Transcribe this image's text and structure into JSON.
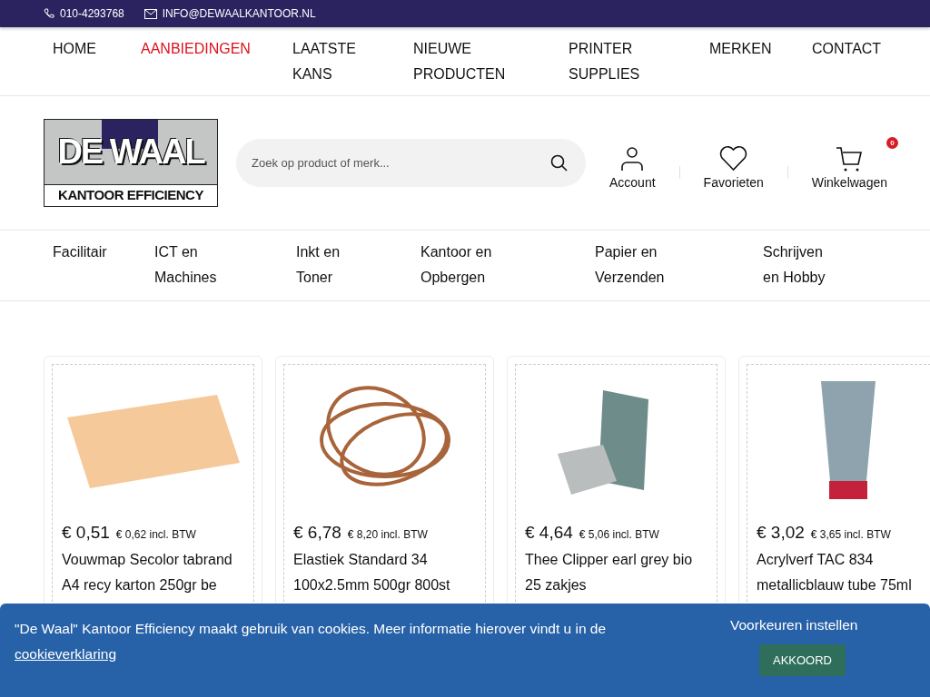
{
  "top_bar": {
    "phone": "010-4293768",
    "email": "INFO@DEWAALKANTOOR.NL"
  },
  "main_nav": [
    {
      "label": "HOME",
      "highlighted": false
    },
    {
      "label": "AANBIEDINGEN",
      "highlighted": true
    },
    {
      "label": "LAATSTE KANS",
      "highlighted": false
    },
    {
      "label": "NIEUWE PRODUCTEN",
      "highlighted": false
    },
    {
      "label": "PRINTER SUPPLIES",
      "highlighted": false
    },
    {
      "label": "MERKEN",
      "highlighted": false
    },
    {
      "label": "CONTACT",
      "highlighted": false
    }
  ],
  "header": {
    "logo": {
      "name": "DE WAAL",
      "tagline": "KANTOOR EFFICIENCY"
    },
    "search": {
      "placeholder": "Zoek op product of merk..."
    },
    "actions": [
      {
        "kind": "account",
        "label": "Account"
      },
      {
        "kind": "favorites",
        "label": "Favorieten"
      },
      {
        "kind": "cart",
        "label": "Winkelwagen",
        "badge": "0"
      }
    ]
  },
  "categories": [
    "Facilitair",
    "ICT en Machines",
    "Inkt en Toner",
    "Kantoor en Opbergen",
    "Papier en Verzenden",
    "Schrijven en Hobby"
  ],
  "products": [
    {
      "kind": "folder",
      "price": "€ 0,51",
      "price_incl": "€ 0,62 incl. BTW",
      "title": "Vouwmap Secolor tabrand A4 recy karton 250gr be"
    },
    {
      "kind": "bands",
      "price": "€ 6,78",
      "price_incl": "€ 8,20 incl. BTW",
      "title": "Elastiek Standard 34 100x2.5mm 500gr 800st"
    },
    {
      "kind": "tea",
      "price": "€ 4,64",
      "price_incl": "€ 5,06 incl. BTW",
      "title": "Thee Clipper earl grey bio 25 zakjes"
    },
    {
      "kind": "tube",
      "price": "€ 3,02",
      "price_incl": "€ 3,65 incl. BTW",
      "title": "Acrylverf TAC 834 metallicblauw tube 75ml"
    }
  ],
  "cookie_banner": {
    "text": "\"De Waal\" Kantoor Efficiency maakt gebruik van cookies. Meer informatie hierover vindt u in de",
    "link": "cookieverklaring",
    "preferences": "Voorkeuren instellen",
    "accept": "AKKOORD"
  }
}
